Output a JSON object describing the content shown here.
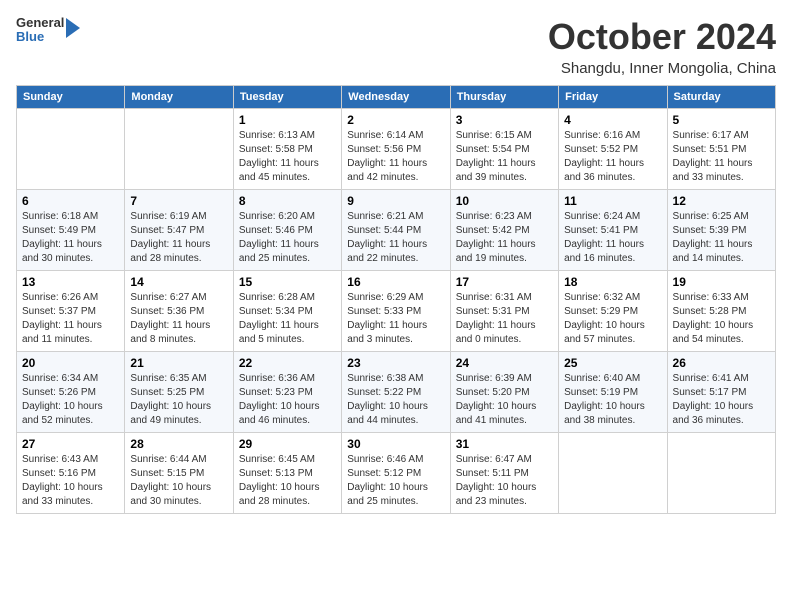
{
  "header": {
    "logo": {
      "general": "General",
      "blue": "Blue"
    },
    "title": "October 2024",
    "location": "Shangdu, Inner Mongolia, China"
  },
  "columns": [
    "Sunday",
    "Monday",
    "Tuesday",
    "Wednesday",
    "Thursday",
    "Friday",
    "Saturday"
  ],
  "weeks": [
    [
      {
        "day": "",
        "info": ""
      },
      {
        "day": "",
        "info": ""
      },
      {
        "day": "1",
        "info": "Sunrise: 6:13 AM\nSunset: 5:58 PM\nDaylight: 11 hours and 45 minutes."
      },
      {
        "day": "2",
        "info": "Sunrise: 6:14 AM\nSunset: 5:56 PM\nDaylight: 11 hours and 42 minutes."
      },
      {
        "day": "3",
        "info": "Sunrise: 6:15 AM\nSunset: 5:54 PM\nDaylight: 11 hours and 39 minutes."
      },
      {
        "day": "4",
        "info": "Sunrise: 6:16 AM\nSunset: 5:52 PM\nDaylight: 11 hours and 36 minutes."
      },
      {
        "day": "5",
        "info": "Sunrise: 6:17 AM\nSunset: 5:51 PM\nDaylight: 11 hours and 33 minutes."
      }
    ],
    [
      {
        "day": "6",
        "info": "Sunrise: 6:18 AM\nSunset: 5:49 PM\nDaylight: 11 hours and 30 minutes."
      },
      {
        "day": "7",
        "info": "Sunrise: 6:19 AM\nSunset: 5:47 PM\nDaylight: 11 hours and 28 minutes."
      },
      {
        "day": "8",
        "info": "Sunrise: 6:20 AM\nSunset: 5:46 PM\nDaylight: 11 hours and 25 minutes."
      },
      {
        "day": "9",
        "info": "Sunrise: 6:21 AM\nSunset: 5:44 PM\nDaylight: 11 hours and 22 minutes."
      },
      {
        "day": "10",
        "info": "Sunrise: 6:23 AM\nSunset: 5:42 PM\nDaylight: 11 hours and 19 minutes."
      },
      {
        "day": "11",
        "info": "Sunrise: 6:24 AM\nSunset: 5:41 PM\nDaylight: 11 hours and 16 minutes."
      },
      {
        "day": "12",
        "info": "Sunrise: 6:25 AM\nSunset: 5:39 PM\nDaylight: 11 hours and 14 minutes."
      }
    ],
    [
      {
        "day": "13",
        "info": "Sunrise: 6:26 AM\nSunset: 5:37 PM\nDaylight: 11 hours and 11 minutes."
      },
      {
        "day": "14",
        "info": "Sunrise: 6:27 AM\nSunset: 5:36 PM\nDaylight: 11 hours and 8 minutes."
      },
      {
        "day": "15",
        "info": "Sunrise: 6:28 AM\nSunset: 5:34 PM\nDaylight: 11 hours and 5 minutes."
      },
      {
        "day": "16",
        "info": "Sunrise: 6:29 AM\nSunset: 5:33 PM\nDaylight: 11 hours and 3 minutes."
      },
      {
        "day": "17",
        "info": "Sunrise: 6:31 AM\nSunset: 5:31 PM\nDaylight: 11 hours and 0 minutes."
      },
      {
        "day": "18",
        "info": "Sunrise: 6:32 AM\nSunset: 5:29 PM\nDaylight: 10 hours and 57 minutes."
      },
      {
        "day": "19",
        "info": "Sunrise: 6:33 AM\nSunset: 5:28 PM\nDaylight: 10 hours and 54 minutes."
      }
    ],
    [
      {
        "day": "20",
        "info": "Sunrise: 6:34 AM\nSunset: 5:26 PM\nDaylight: 10 hours and 52 minutes."
      },
      {
        "day": "21",
        "info": "Sunrise: 6:35 AM\nSunset: 5:25 PM\nDaylight: 10 hours and 49 minutes."
      },
      {
        "day": "22",
        "info": "Sunrise: 6:36 AM\nSunset: 5:23 PM\nDaylight: 10 hours and 46 minutes."
      },
      {
        "day": "23",
        "info": "Sunrise: 6:38 AM\nSunset: 5:22 PM\nDaylight: 10 hours and 44 minutes."
      },
      {
        "day": "24",
        "info": "Sunrise: 6:39 AM\nSunset: 5:20 PM\nDaylight: 10 hours and 41 minutes."
      },
      {
        "day": "25",
        "info": "Sunrise: 6:40 AM\nSunset: 5:19 PM\nDaylight: 10 hours and 38 minutes."
      },
      {
        "day": "26",
        "info": "Sunrise: 6:41 AM\nSunset: 5:17 PM\nDaylight: 10 hours and 36 minutes."
      }
    ],
    [
      {
        "day": "27",
        "info": "Sunrise: 6:43 AM\nSunset: 5:16 PM\nDaylight: 10 hours and 33 minutes."
      },
      {
        "day": "28",
        "info": "Sunrise: 6:44 AM\nSunset: 5:15 PM\nDaylight: 10 hours and 30 minutes."
      },
      {
        "day": "29",
        "info": "Sunrise: 6:45 AM\nSunset: 5:13 PM\nDaylight: 10 hours and 28 minutes."
      },
      {
        "day": "30",
        "info": "Sunrise: 6:46 AM\nSunset: 5:12 PM\nDaylight: 10 hours and 25 minutes."
      },
      {
        "day": "31",
        "info": "Sunrise: 6:47 AM\nSunset: 5:11 PM\nDaylight: 10 hours and 23 minutes."
      },
      {
        "day": "",
        "info": ""
      },
      {
        "day": "",
        "info": ""
      }
    ]
  ]
}
